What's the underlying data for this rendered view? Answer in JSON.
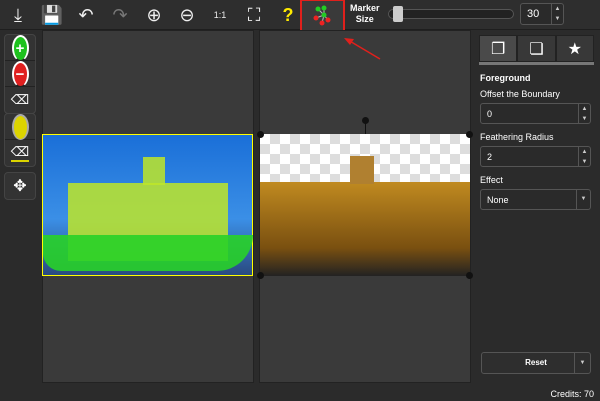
{
  "toolbar": {
    "marker_size_label": "Marker\nSize",
    "marker_size_value": "30",
    "marker_size_fraction": 0.05,
    "help": "?"
  },
  "left_tools": {},
  "panel": {
    "tabs": [
      "foreground",
      "background",
      "effects"
    ],
    "section": "Foreground",
    "offset_label": "Offset the Boundary",
    "offset_value": "0",
    "feather_label": "Feathering Radius",
    "feather_value": "2",
    "effect_label": "Effect",
    "effect_value": "None",
    "reset_label": "Reset",
    "credits": "Credits: 70"
  },
  "colors": {
    "highlight": "#e0201c",
    "accent_yellow": "#ffea00"
  }
}
